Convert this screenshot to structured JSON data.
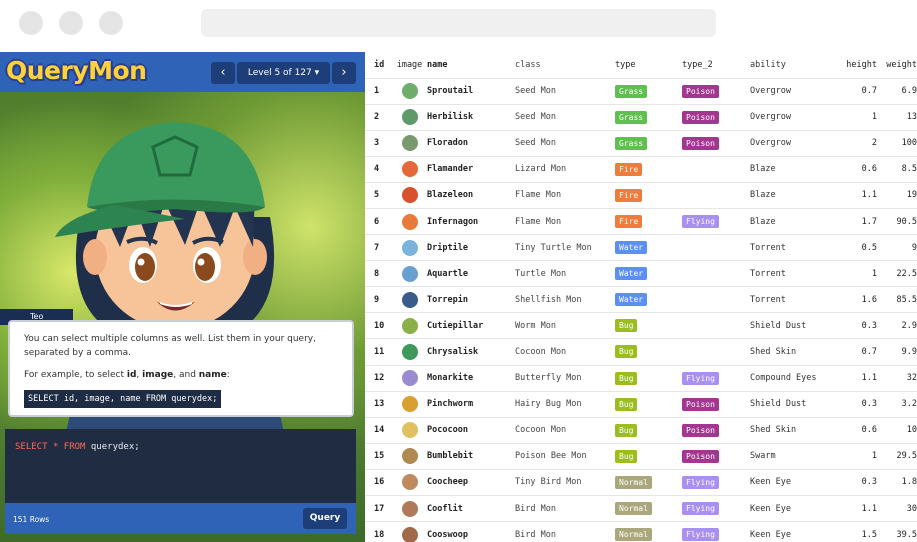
{
  "app": {
    "logo": "QueryMon",
    "level_label": "Level 5 of 127 ▾",
    "prev_icon": "‹",
    "next_icon": "›"
  },
  "dialog": {
    "speaker": "Teo",
    "line1": "You can select multiple columns as well. List them in your query, separated by a comma.",
    "line2_prefix": "For example, to select ",
    "line2_id": "id",
    "line2_sep": ", ",
    "line2_image": "image",
    "line2_and": ", and ",
    "line2_name": "name",
    "line2_suffix": ":",
    "code_example": "SELECT id, image, name FROM querydex;"
  },
  "editor": {
    "kw_select": "SELECT",
    "star": "*",
    "kw_from": "FROM",
    "table": "querydex;"
  },
  "status": {
    "rows": "151 Rows",
    "query_button": "Query"
  },
  "table": {
    "headers": [
      "id",
      "image",
      "name",
      "class",
      "type",
      "type_2",
      "ability",
      "height",
      "weight"
    ],
    "type_colors": {
      "Grass": "#5fbf4f",
      "Poison": "#a3368f",
      "Fire": "#f07b3a",
      "Flying": "#a98ff0",
      "Water": "#5b8ff0",
      "Bug": "#9bbd20",
      "Normal": "#a9a77b"
    },
    "rows": [
      {
        "id": "1",
        "name": "Sproutail",
        "class": "Seed Mon",
        "type": "Grass",
        "type_2": "Poison",
        "ability": "Overgrow",
        "height": "0.7",
        "weight": "6.9",
        "sprite": "#6fae6a"
      },
      {
        "id": "2",
        "name": "Herbilisk",
        "class": "Seed Mon",
        "type": "Grass",
        "type_2": "Poison",
        "ability": "Overgrow",
        "height": "1",
        "weight": "13",
        "sprite": "#5e9a6a"
      },
      {
        "id": "3",
        "name": "Floradon",
        "class": "Seed Mon",
        "type": "Grass",
        "type_2": "Poison",
        "ability": "Overgrow",
        "height": "2",
        "weight": "100",
        "sprite": "#7a9a6e"
      },
      {
        "id": "4",
        "name": "Flamander",
        "class": "Lizard Mon",
        "type": "Fire",
        "type_2": "",
        "ability": "Blaze",
        "height": "0.6",
        "weight": "8.5",
        "sprite": "#e4683a"
      },
      {
        "id": "5",
        "name": "Blazeleon",
        "class": "Flame Mon",
        "type": "Fire",
        "type_2": "",
        "ability": "Blaze",
        "height": "1.1",
        "weight": "19",
        "sprite": "#d8502e"
      },
      {
        "id": "6",
        "name": "Infernagon",
        "class": "Flame Mon",
        "type": "Fire",
        "type_2": "Flying",
        "ability": "Blaze",
        "height": "1.7",
        "weight": "90.5",
        "sprite": "#e87a3a"
      },
      {
        "id": "7",
        "name": "Driptile",
        "class": "Tiny Turtle Mon",
        "type": "Water",
        "type_2": "",
        "ability": "Torrent",
        "height": "0.5",
        "weight": "9",
        "sprite": "#7ab4dc"
      },
      {
        "id": "8",
        "name": "Aquartle",
        "class": "Turtle Mon",
        "type": "Water",
        "type_2": "",
        "ability": "Torrent",
        "height": "1",
        "weight": "22.5",
        "sprite": "#6aa0d0"
      },
      {
        "id": "9",
        "name": "Torrepin",
        "class": "Shellfish Mon",
        "type": "Water",
        "type_2": "",
        "ability": "Torrent",
        "height": "1.6",
        "weight": "85.5",
        "sprite": "#3a5a8a"
      },
      {
        "id": "10",
        "name": "Cutiepillar",
        "class": "Worm Mon",
        "type": "Bug",
        "type_2": "",
        "ability": "Shield Dust",
        "height": "0.3",
        "weight": "2.9",
        "sprite": "#8ab04a"
      },
      {
        "id": "11",
        "name": "Chrysalisk",
        "class": "Cocoon Mon",
        "type": "Bug",
        "type_2": "",
        "ability": "Shed Skin",
        "height": "0.7",
        "weight": "9.9",
        "sprite": "#3f9a5a"
      },
      {
        "id": "12",
        "name": "Monarkite",
        "class": "Butterfly Mon",
        "type": "Bug",
        "type_2": "Flying",
        "ability": "Compound Eyes",
        "height": "1.1",
        "weight": "32",
        "sprite": "#9a8ad0"
      },
      {
        "id": "13",
        "name": "Pinchworm",
        "class": "Hairy Bug Mon",
        "type": "Bug",
        "type_2": "Poison",
        "ability": "Shield Dust",
        "height": "0.3",
        "weight": "3.2",
        "sprite": "#d8a030"
      },
      {
        "id": "14",
        "name": "Pococoon",
        "class": "Cocoon Mon",
        "type": "Bug",
        "type_2": "Poison",
        "ability": "Shed Skin",
        "height": "0.6",
        "weight": "10",
        "sprite": "#e0c060"
      },
      {
        "id": "15",
        "name": "Bumblebit",
        "class": "Poison Bee Mon",
        "type": "Bug",
        "type_2": "Poison",
        "ability": "Swarm",
        "height": "1",
        "weight": "29.5",
        "sprite": "#b08a50"
      },
      {
        "id": "16",
        "name": "Coocheep",
        "class": "Tiny Bird Mon",
        "type": "Normal",
        "type_2": "Flying",
        "ability": "Keen Eye",
        "height": "0.3",
        "weight": "1.8",
        "sprite": "#c08a60"
      },
      {
        "id": "17",
        "name": "Cooflit",
        "class": "Bird Mon",
        "type": "Normal",
        "type_2": "Flying",
        "ability": "Keen Eye",
        "height": "1.1",
        "weight": "30",
        "sprite": "#b07a5a"
      },
      {
        "id": "18",
        "name": "Cooswoop",
        "class": "Bird Mon",
        "type": "Normal",
        "type_2": "Flying",
        "ability": "Keen Eye",
        "height": "1.5",
        "weight": "39.5",
        "sprite": "#a06a4a"
      }
    ]
  }
}
